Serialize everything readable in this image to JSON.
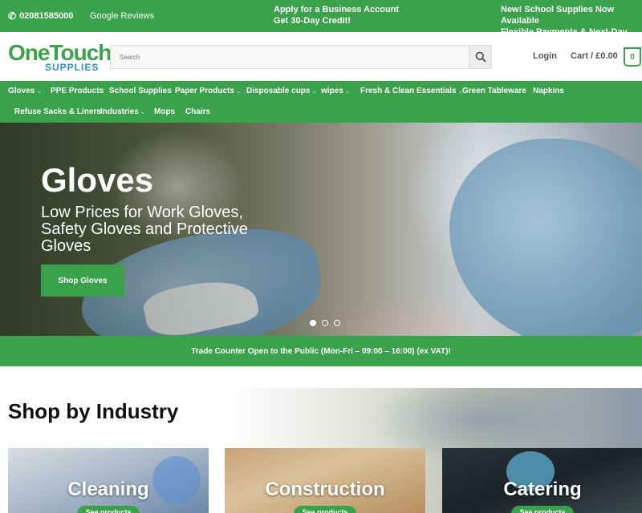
{
  "topbar": {
    "phone": "02081585000",
    "reviews": "Google Reviews",
    "promo_line1": "Apply for a Business Account",
    "promo_line2": "Get 30-Day Credit!",
    "news_line1": "New! School Supplies Now Available",
    "news_line2": "Flexible Payments & Next-Day Delivery"
  },
  "header": {
    "logo_one": "OneTouch",
    "logo_sub": "SUPPLIES",
    "search_placeholder": "Search",
    "login": "Login",
    "cart": "Cart / £0.00",
    "cart_count": "0"
  },
  "nav": {
    "items": [
      {
        "label": "Gloves",
        "has_dropdown": true
      },
      {
        "label": "PPE Products",
        "has_dropdown": false
      },
      {
        "label": "School Supplies",
        "has_dropdown": false
      },
      {
        "label": "Paper Products",
        "has_dropdown": true
      },
      {
        "label": "Disposable cups",
        "has_dropdown": true
      },
      {
        "label": "wipes",
        "has_dropdown": true
      },
      {
        "label": "Fresh & Clean Essentials",
        "has_dropdown": true
      },
      {
        "label": "Green Tableware",
        "has_dropdown": false
      },
      {
        "label": "Napkins",
        "has_dropdown": false
      },
      {
        "label": "Refuse Sacks & Liners",
        "has_dropdown": false
      },
      {
        "label": "Industries",
        "has_dropdown": true
      },
      {
        "label": "Mops",
        "has_dropdown": false
      },
      {
        "label": "Chairs",
        "has_dropdown": false
      }
    ]
  },
  "hero": {
    "title": "Gloves",
    "subtitle": "Low Prices for Work Gloves, Safety Gloves and Protective Gloves",
    "button": "Shop Gloves",
    "slides": 3,
    "active_slide": 1
  },
  "notice": "Trade Counter Open to the Public (Mon-Fri – 09:00 – 16:00) (ex VAT)!",
  "industry": {
    "title": "Shop by Industry",
    "cards": [
      {
        "label": "Cleaning",
        "button": "See products"
      },
      {
        "label": "Construction",
        "button": "See products"
      },
      {
        "label": "Catering",
        "button": "See products"
      }
    ]
  },
  "colors": {
    "brand_green": "#3aa24a",
    "logo_blue": "#2a8fd0"
  },
  "icons": [
    "phone-icon",
    "search-icon",
    "chevron-down-icon"
  ]
}
